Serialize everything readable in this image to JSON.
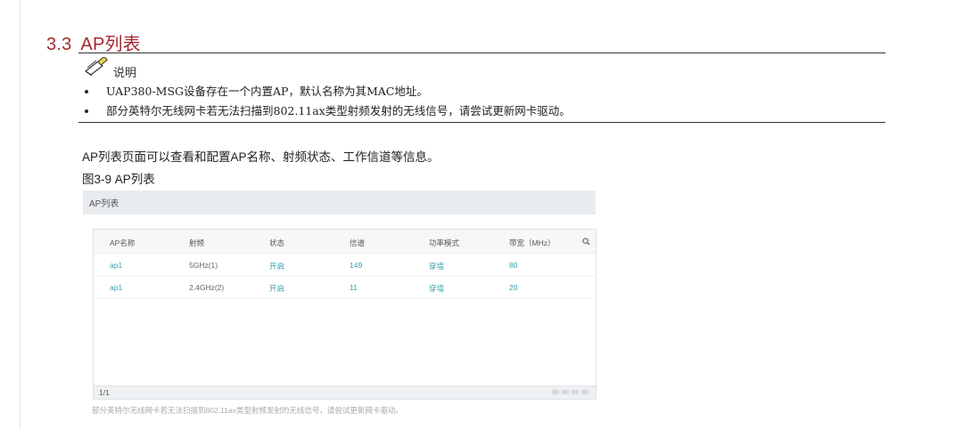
{
  "section": {
    "number": "3.3",
    "title": "AP列表"
  },
  "note": {
    "label": "说明",
    "items": [
      "UAP380-MSG设备存在一个内置AP，默认名称为其MAC地址。",
      "部分英特尔无线网卡若无法扫描到802.11ax类型射频发射的无线信号，请尝试更新网卡驱动。"
    ]
  },
  "intro": "AP列表页面可以查看和配置AP名称、射频状态、工作信道等信息。",
  "figure": {
    "caption": "图3-9 AP列表",
    "header_title": "AP列表",
    "columns": [
      "AP名称",
      "射频",
      "状态",
      "信道",
      "功率模式",
      "带宽（MHz）"
    ],
    "rows": [
      [
        "ap1",
        "5GHz(1)",
        "开启",
        "149",
        "穿墙",
        "80"
      ],
      [
        "ap1",
        "2.4GHz(2)",
        "开启",
        "11",
        "穿墙",
        "20"
      ]
    ],
    "pager": "1/1",
    "footnote": "部分英特尔无线网卡若无法扫描到802.11ax类型射频发射的无线信号，请尝试更新网卡驱动。"
  },
  "colors": {
    "heading": "#a4282f",
    "link": "#3aa0ad"
  },
  "icons": {
    "note": "note-pencil-icon",
    "search": "search-icon"
  }
}
